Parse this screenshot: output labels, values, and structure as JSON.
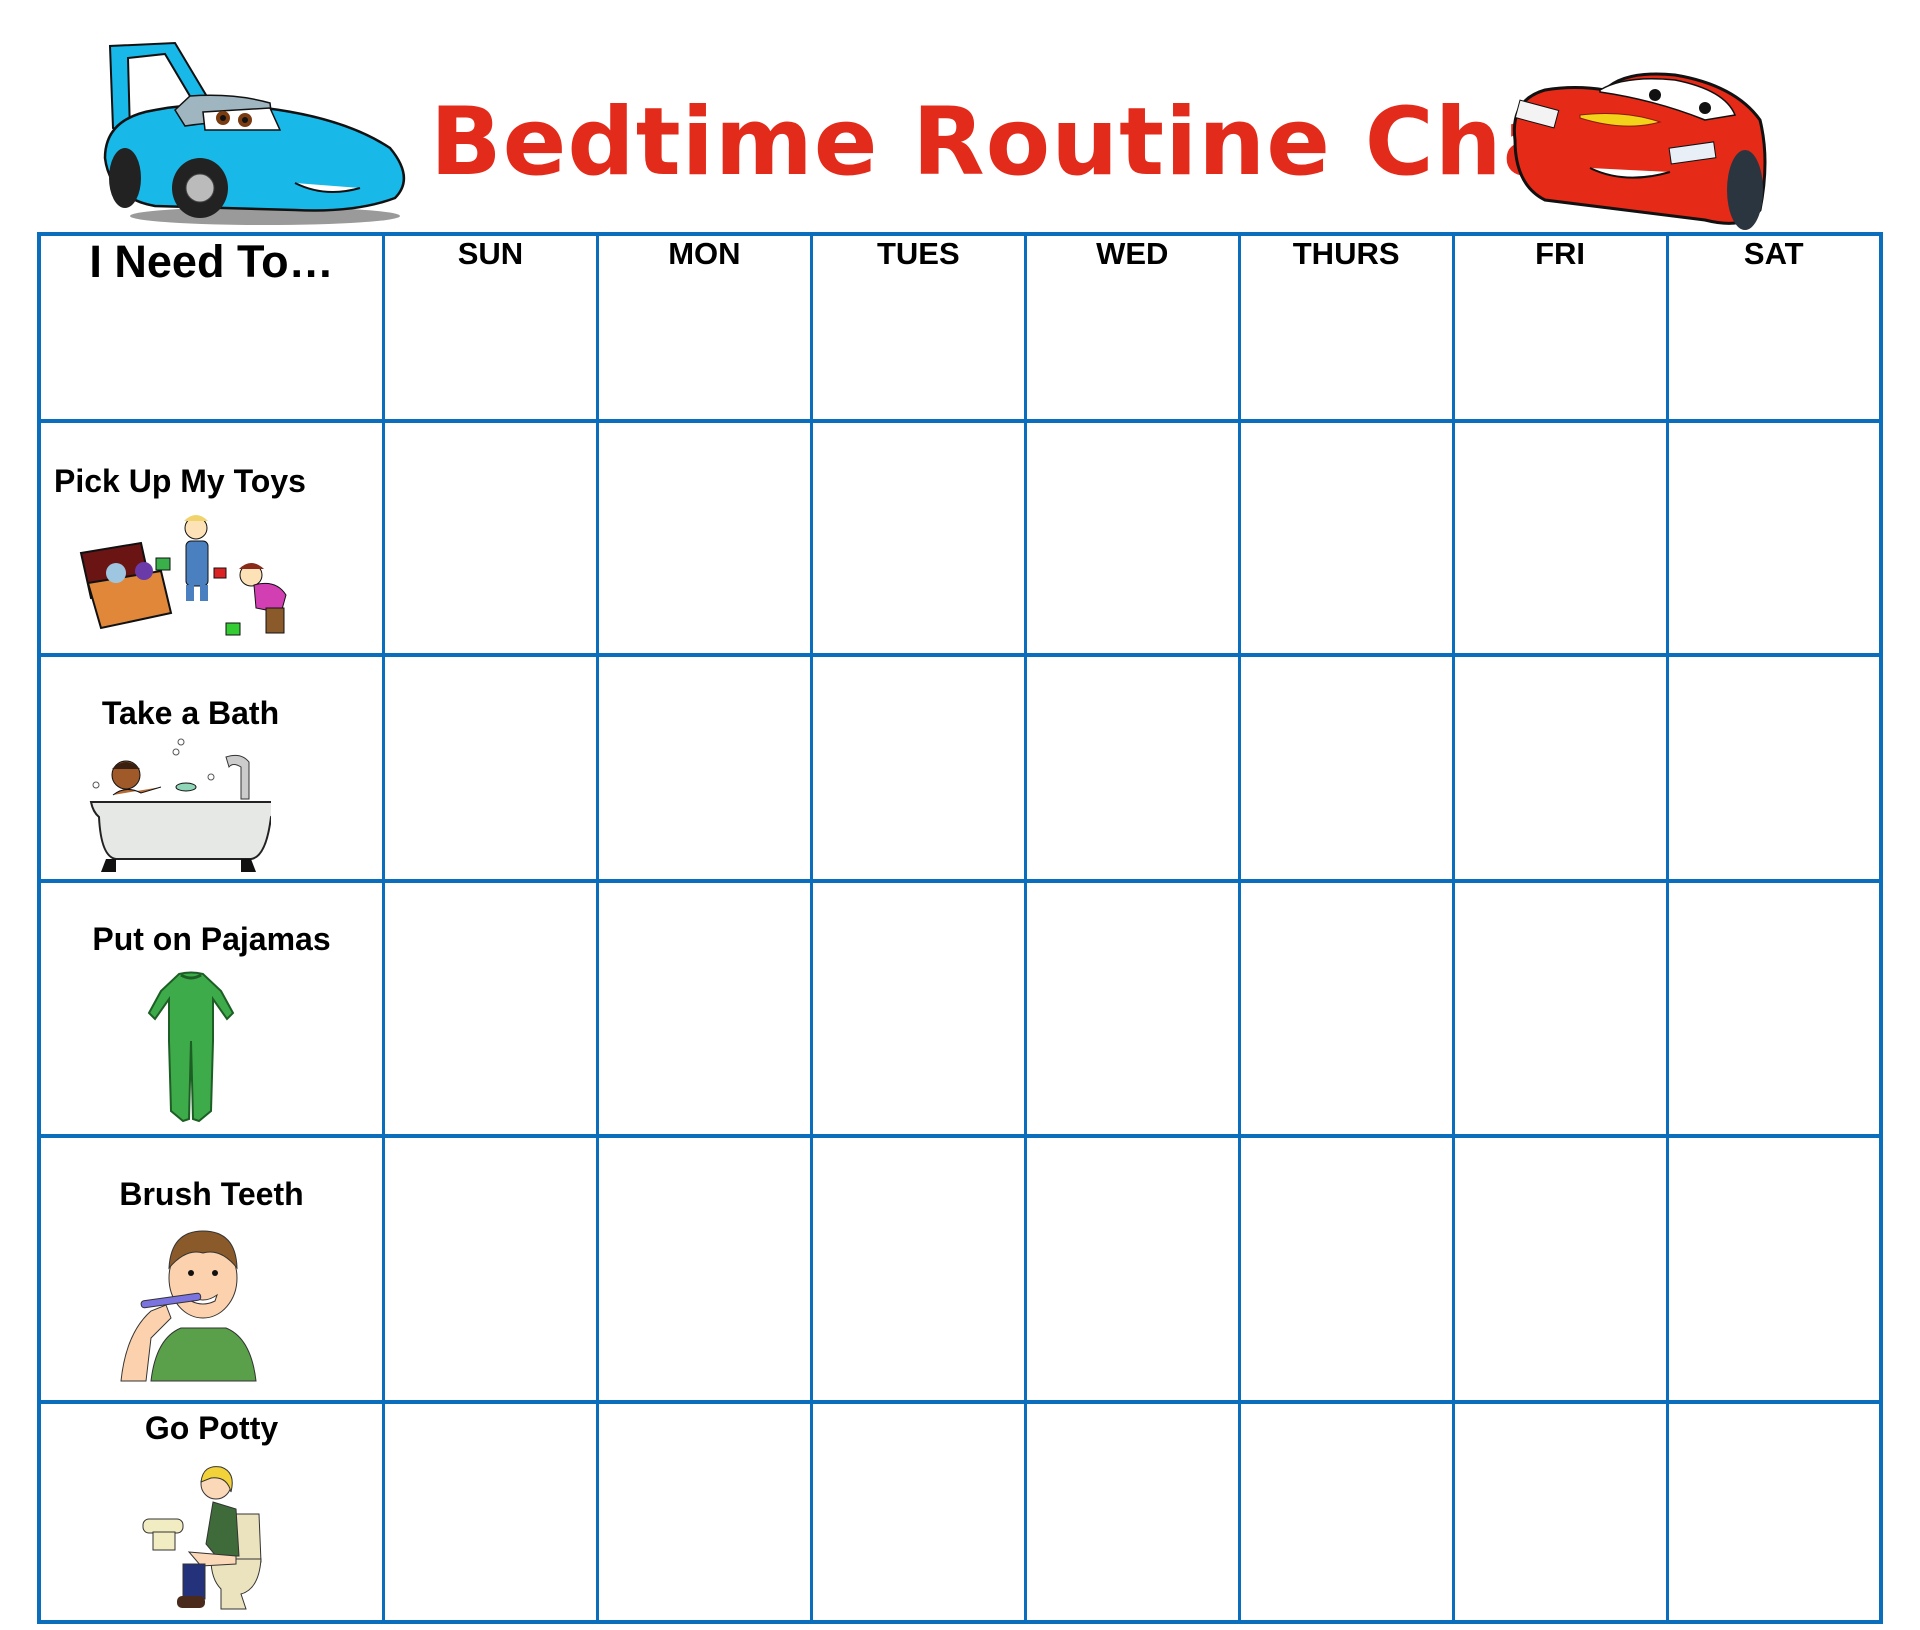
{
  "title": "Bedtime Routine Chart",
  "colors": {
    "title": "#E32B1B",
    "grid": "#0A6EBD",
    "text": "#000000"
  },
  "decorations": {
    "left_image": "blue-race-car-icon",
    "right_image": "red-race-car-icon"
  },
  "table": {
    "task_header": "I Need To…",
    "days": [
      "SUN",
      "MON",
      "TUES",
      "WED",
      "THURS",
      "FRI",
      "SAT"
    ],
    "tasks": [
      {
        "label": "Pick Up My Toys",
        "icon": "toys-cleanup-icon"
      },
      {
        "label": "Take a Bath",
        "icon": "bathtub-icon"
      },
      {
        "label": "Put on Pajamas",
        "icon": "pajamas-icon"
      },
      {
        "label": "Brush Teeth",
        "icon": "toothbrush-boy-icon"
      },
      {
        "label": "Go Potty",
        "icon": "potty-icon"
      }
    ]
  }
}
